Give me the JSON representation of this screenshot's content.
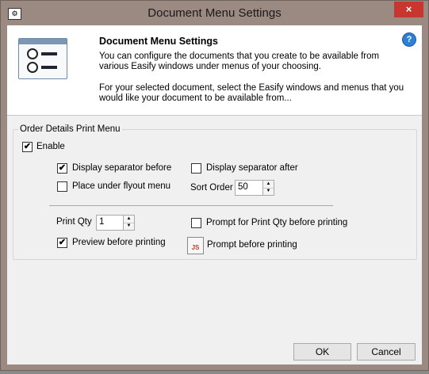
{
  "window": {
    "title": "Document Menu Settings",
    "close_glyph": "×"
  },
  "header": {
    "title": "Document Menu Settings",
    "description_1": "You can configure the documents that you create to be available from various Easify windows under menus of your choosing.",
    "description_2": "For your selected document, select the Easify windows and menus that you would like your document to be available from...",
    "help_glyph": "?"
  },
  "group": {
    "legend": "Order Details Print Menu",
    "enable": {
      "label": "Enable",
      "checked": true
    },
    "display_separator_before": {
      "label": "Display separator before",
      "checked": true
    },
    "display_separator_after": {
      "label": "Display separator after",
      "checked": false
    },
    "place_under_flyout": {
      "label": "Place under flyout menu",
      "checked": false
    },
    "sort_order": {
      "label": "Sort Order",
      "value": "50"
    },
    "print_qty": {
      "label": "Print Qty",
      "value": "1"
    },
    "prompt_print_qty": {
      "label": "Prompt for Print Qty before printing",
      "checked": false
    },
    "preview_before_printing": {
      "label": "Preview before printing",
      "checked": true
    },
    "prompt_before_printing": {
      "label": "Prompt before printing",
      "icon_text": "JS"
    }
  },
  "buttons": {
    "ok": "OK",
    "cancel": "Cancel"
  },
  "glyphs": {
    "check": "✔",
    "up": "▲",
    "down": "▼"
  }
}
